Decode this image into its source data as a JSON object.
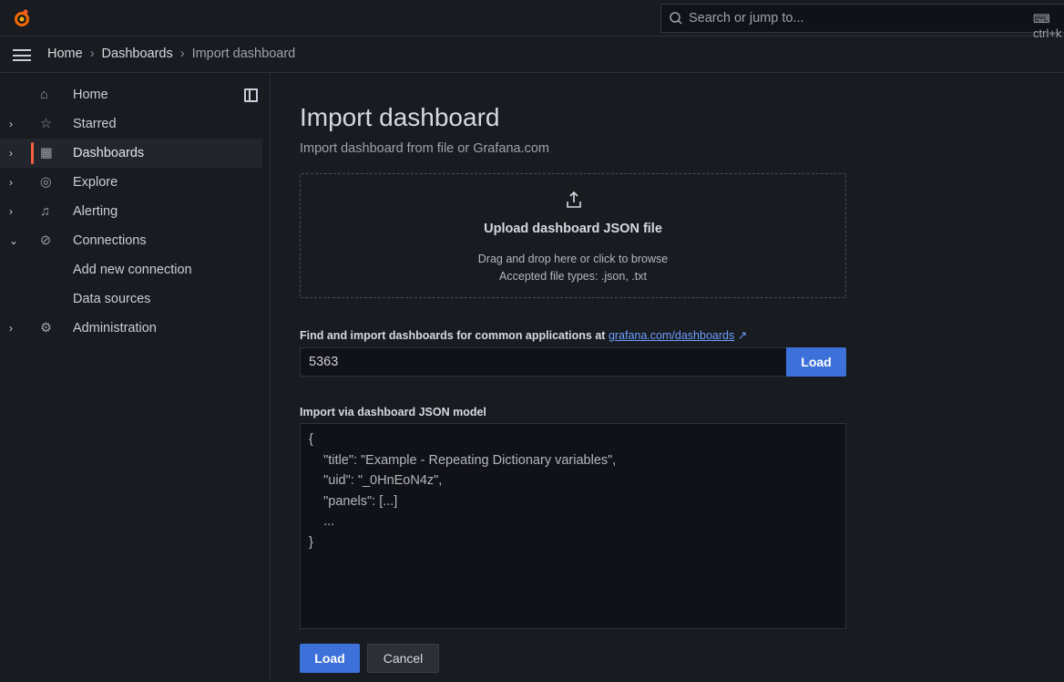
{
  "topbar": {
    "search_placeholder": "Search or jump to...",
    "shortcut": "ctrl+k"
  },
  "breadcrumb": [
    "Home",
    "Dashboards",
    "Import dashboard"
  ],
  "sidebar": {
    "items": [
      {
        "label": "Home",
        "icon": "home-icon",
        "chevron": ""
      },
      {
        "label": "Starred",
        "icon": "star-icon",
        "chevron": "›"
      },
      {
        "label": "Dashboards",
        "icon": "apps-icon",
        "chevron": "›",
        "active": true
      },
      {
        "label": "Explore",
        "icon": "compass-icon",
        "chevron": "›"
      },
      {
        "label": "Alerting",
        "icon": "bell-icon",
        "chevron": "›"
      },
      {
        "label": "Connections",
        "icon": "link-icon",
        "chevron": "⌄"
      },
      {
        "label": "Add new connection",
        "icon": "",
        "chevron": ""
      },
      {
        "label": "Data sources",
        "icon": "",
        "chevron": ""
      },
      {
        "label": "Administration",
        "icon": "gear-icon",
        "chevron": "›"
      }
    ]
  },
  "main": {
    "title": "Import dashboard",
    "subtitle": "Import dashboard from file or Grafana.com",
    "upload": {
      "title": "Upload dashboard JSON file",
      "hint1": "Drag and drop here or click to browse",
      "hint2": "Accepted file types: .json, .txt"
    },
    "gcom": {
      "label": "Find and import dashboards for common applications at",
      "link": "grafana.com/dashboards",
      "value": "5363",
      "load": "Load"
    },
    "json": {
      "label": "Import via dashboard JSON model",
      "placeholder": "{\n    \"title\": \"Example - Repeating Dictionary variables\",\n    \"uid\": \"_0HnEoN4z\",\n    \"panels\": [...]\n    ...\n}"
    },
    "load": "Load",
    "cancel": "Cancel"
  },
  "colors": {
    "accent": "#3d71d9",
    "active_indicator": "#f55f3e"
  }
}
